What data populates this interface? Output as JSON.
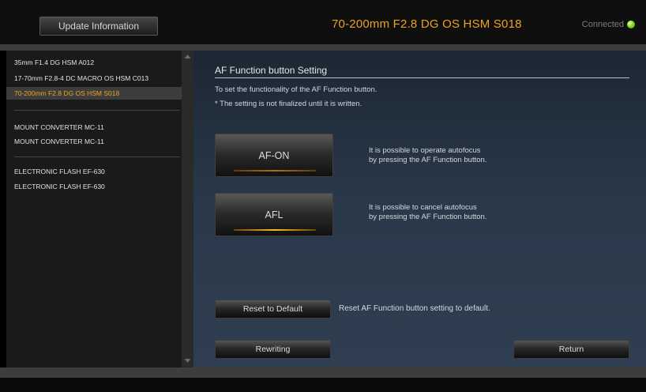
{
  "header": {
    "update_label": "Update Information",
    "lens_title": "70-200mm  F2.8  DG OS HSM  S018",
    "status_label": "Connected",
    "status_color": "#7ccc16",
    "accent_color": "#f0a21c"
  },
  "sidebar": {
    "lenses": [
      {
        "label": "35mm F1.4 DG HSM A012",
        "active": false
      },
      {
        "label": "17-70mm F2.8-4 DC MACRO OS HSM C013",
        "active": false
      },
      {
        "label": "70-200mm F2.8 DG OS HSM S018",
        "active": true
      }
    ],
    "converters": [
      {
        "label": "MOUNT CONVERTER MC-11"
      },
      {
        "label": "MOUNT CONVERTER MC-11"
      }
    ],
    "flashes": [
      {
        "label": "ELECTRONIC FLASH EF-630"
      },
      {
        "label": "ELECTRONIC FLASH EF-630"
      }
    ]
  },
  "main": {
    "section_title": "AF Function button Setting",
    "desc_line1": "To set the functionality of the AF Function button.",
    "desc_line2": "* The setting is not finalized until it is written.",
    "options": [
      {
        "label": "AF-ON",
        "selected": false,
        "desc_line1": "It is possible to operate autofocus",
        "desc_line2": "by pressing the AF Function button."
      },
      {
        "label": "AFL",
        "selected": true,
        "desc_line1": "It is possible to cancel autofocus",
        "desc_line2": "by pressing the AF Function button."
      }
    ],
    "reset_label": "Reset to Default",
    "reset_desc": "Reset AF Function button setting to default.",
    "rewriting_label": "Rewriting",
    "return_label": "Return"
  }
}
